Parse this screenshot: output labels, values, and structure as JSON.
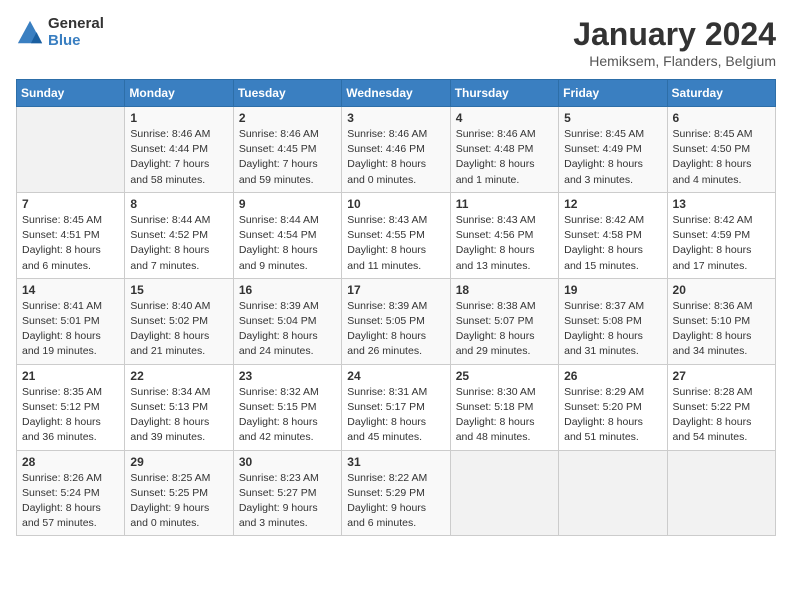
{
  "logo": {
    "general": "General",
    "blue": "Blue"
  },
  "title": "January 2024",
  "subtitle": "Hemiksem, Flanders, Belgium",
  "days_of_week": [
    "Sunday",
    "Monday",
    "Tuesday",
    "Wednesday",
    "Thursday",
    "Friday",
    "Saturday"
  ],
  "weeks": [
    [
      {
        "day": "",
        "content": ""
      },
      {
        "day": "1",
        "content": "Sunrise: 8:46 AM\nSunset: 4:44 PM\nDaylight: 7 hours\nand 58 minutes."
      },
      {
        "day": "2",
        "content": "Sunrise: 8:46 AM\nSunset: 4:45 PM\nDaylight: 7 hours\nand 59 minutes."
      },
      {
        "day": "3",
        "content": "Sunrise: 8:46 AM\nSunset: 4:46 PM\nDaylight: 8 hours\nand 0 minutes."
      },
      {
        "day": "4",
        "content": "Sunrise: 8:46 AM\nSunset: 4:48 PM\nDaylight: 8 hours\nand 1 minute."
      },
      {
        "day": "5",
        "content": "Sunrise: 8:45 AM\nSunset: 4:49 PM\nDaylight: 8 hours\nand 3 minutes."
      },
      {
        "day": "6",
        "content": "Sunrise: 8:45 AM\nSunset: 4:50 PM\nDaylight: 8 hours\nand 4 minutes."
      }
    ],
    [
      {
        "day": "7",
        "content": "Sunrise: 8:45 AM\nSunset: 4:51 PM\nDaylight: 8 hours\nand 6 minutes."
      },
      {
        "day": "8",
        "content": "Sunrise: 8:44 AM\nSunset: 4:52 PM\nDaylight: 8 hours\nand 7 minutes."
      },
      {
        "day": "9",
        "content": "Sunrise: 8:44 AM\nSunset: 4:54 PM\nDaylight: 8 hours\nand 9 minutes."
      },
      {
        "day": "10",
        "content": "Sunrise: 8:43 AM\nSunset: 4:55 PM\nDaylight: 8 hours\nand 11 minutes."
      },
      {
        "day": "11",
        "content": "Sunrise: 8:43 AM\nSunset: 4:56 PM\nDaylight: 8 hours\nand 13 minutes."
      },
      {
        "day": "12",
        "content": "Sunrise: 8:42 AM\nSunset: 4:58 PM\nDaylight: 8 hours\nand 15 minutes."
      },
      {
        "day": "13",
        "content": "Sunrise: 8:42 AM\nSunset: 4:59 PM\nDaylight: 8 hours\nand 17 minutes."
      }
    ],
    [
      {
        "day": "14",
        "content": "Sunrise: 8:41 AM\nSunset: 5:01 PM\nDaylight: 8 hours\nand 19 minutes."
      },
      {
        "day": "15",
        "content": "Sunrise: 8:40 AM\nSunset: 5:02 PM\nDaylight: 8 hours\nand 21 minutes."
      },
      {
        "day": "16",
        "content": "Sunrise: 8:39 AM\nSunset: 5:04 PM\nDaylight: 8 hours\nand 24 minutes."
      },
      {
        "day": "17",
        "content": "Sunrise: 8:39 AM\nSunset: 5:05 PM\nDaylight: 8 hours\nand 26 minutes."
      },
      {
        "day": "18",
        "content": "Sunrise: 8:38 AM\nSunset: 5:07 PM\nDaylight: 8 hours\nand 29 minutes."
      },
      {
        "day": "19",
        "content": "Sunrise: 8:37 AM\nSunset: 5:08 PM\nDaylight: 8 hours\nand 31 minutes."
      },
      {
        "day": "20",
        "content": "Sunrise: 8:36 AM\nSunset: 5:10 PM\nDaylight: 8 hours\nand 34 minutes."
      }
    ],
    [
      {
        "day": "21",
        "content": "Sunrise: 8:35 AM\nSunset: 5:12 PM\nDaylight: 8 hours\nand 36 minutes."
      },
      {
        "day": "22",
        "content": "Sunrise: 8:34 AM\nSunset: 5:13 PM\nDaylight: 8 hours\nand 39 minutes."
      },
      {
        "day": "23",
        "content": "Sunrise: 8:32 AM\nSunset: 5:15 PM\nDaylight: 8 hours\nand 42 minutes."
      },
      {
        "day": "24",
        "content": "Sunrise: 8:31 AM\nSunset: 5:17 PM\nDaylight: 8 hours\nand 45 minutes."
      },
      {
        "day": "25",
        "content": "Sunrise: 8:30 AM\nSunset: 5:18 PM\nDaylight: 8 hours\nand 48 minutes."
      },
      {
        "day": "26",
        "content": "Sunrise: 8:29 AM\nSunset: 5:20 PM\nDaylight: 8 hours\nand 51 minutes."
      },
      {
        "day": "27",
        "content": "Sunrise: 8:28 AM\nSunset: 5:22 PM\nDaylight: 8 hours\nand 54 minutes."
      }
    ],
    [
      {
        "day": "28",
        "content": "Sunrise: 8:26 AM\nSunset: 5:24 PM\nDaylight: 8 hours\nand 57 minutes."
      },
      {
        "day": "29",
        "content": "Sunrise: 8:25 AM\nSunset: 5:25 PM\nDaylight: 9 hours\nand 0 minutes."
      },
      {
        "day": "30",
        "content": "Sunrise: 8:23 AM\nSunset: 5:27 PM\nDaylight: 9 hours\nand 3 minutes."
      },
      {
        "day": "31",
        "content": "Sunrise: 8:22 AM\nSunset: 5:29 PM\nDaylight: 9 hours\nand 6 minutes."
      },
      {
        "day": "",
        "content": ""
      },
      {
        "day": "",
        "content": ""
      },
      {
        "day": "",
        "content": ""
      }
    ]
  ]
}
